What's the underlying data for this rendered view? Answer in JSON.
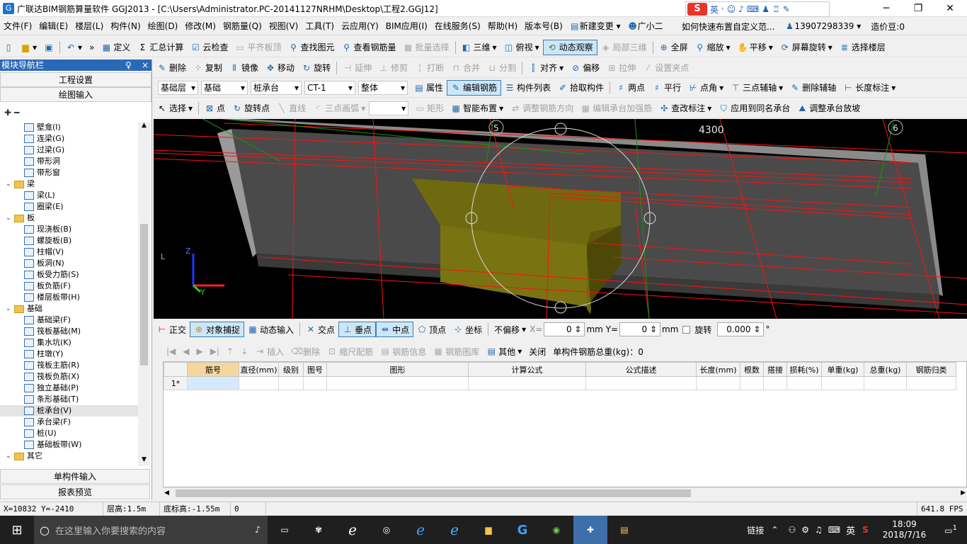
{
  "window": {
    "title": "广联达BIM钢筋算量软件 GGJ2013 - [C:\\Users\\Administrator.PC-20141127NRHM\\Desktop\\工程2.GGJ12]",
    "app_icon": "G"
  },
  "ime": {
    "logo": "S",
    "lang": "英",
    "icons": [
      "comma-icon",
      "smile-icon",
      "mic-icon",
      "keyboard-icon",
      "user-icon",
      "shirt-icon",
      "wrench-icon"
    ]
  },
  "window_controls": {
    "minimize": "─",
    "restore": "❐",
    "close": "✕"
  },
  "menu": [
    "文件(F)",
    "编辑(E)",
    "楼层(L)",
    "构件(N)",
    "绘图(D)",
    "修改(M)",
    "钢筋量(Q)",
    "视图(V)",
    "工具(T)",
    "云应用(Y)",
    "BIM应用(I)",
    "在线服务(S)",
    "帮助(H)",
    "版本号(B)",
    "新建变更",
    "广小二"
  ],
  "menu_right": {
    "hint": "如何快速布置自定义范...",
    "phone": "13907298339",
    "price": "造价豆:0"
  },
  "toolbar1": {
    "items": [
      "定义",
      "汇总计算",
      "云检查",
      "平齐板顶",
      "查找图元",
      "查看钢筋量",
      "批量选择",
      "三维",
      "俯视",
      "动态观察",
      "局部三维",
      "全屏",
      "缩放",
      "平移",
      "屏幕旋转",
      "选择楼层"
    ]
  },
  "toolbar2": {
    "items": [
      "删除",
      "复制",
      "镜像",
      "移动",
      "旋转",
      "延伸",
      "修剪",
      "打断",
      "合并",
      "分割",
      "对齐",
      "偏移",
      "拉伸",
      "设置夹点"
    ]
  },
  "toolbar3": {
    "layer_type": "基础层",
    "layer": "基础",
    "component_type": "桩承台",
    "component": "CT-1",
    "mode": "整体",
    "items": [
      "属性",
      "编辑钢筋",
      "构件列表",
      "拾取构件",
      "两点",
      "平行",
      "点角",
      "三点辅轴",
      "删除辅轴",
      "长度标注"
    ]
  },
  "toolbar4": {
    "items": [
      "选择",
      "点",
      "旋转点",
      "直线",
      "三点画弧",
      "矩形",
      "智能布置",
      "调整钢筋方向",
      "编辑承台加强筋",
      "查改标注",
      "应用到同名承台",
      "调整承台放坡"
    ]
  },
  "nav": {
    "title": "模块导航栏",
    "pin": "♀",
    "close": "×",
    "project_settings": "工程设置",
    "drawing_input": "绘图输入",
    "single_input": "单构件输入",
    "report_preview": "报表预览",
    "tree": [
      {
        "label": "壁龛(I)",
        "level": 2
      },
      {
        "label": "连梁(G)",
        "level": 2
      },
      {
        "label": "过梁(G)",
        "level": 2
      },
      {
        "label": "带形洞",
        "level": 2
      },
      {
        "label": "带形窗",
        "level": 2
      },
      {
        "label": "梁",
        "level": 1,
        "folder": true
      },
      {
        "label": "梁(L)",
        "level": 2
      },
      {
        "label": "圈梁(E)",
        "level": 2
      },
      {
        "label": "板",
        "level": 1,
        "folder": true
      },
      {
        "label": "现浇板(B)",
        "level": 2
      },
      {
        "label": "螺旋板(B)",
        "level": 2
      },
      {
        "label": "柱帽(V)",
        "level": 2
      },
      {
        "label": "板洞(N)",
        "level": 2
      },
      {
        "label": "板受力筋(S)",
        "level": 2
      },
      {
        "label": "板负筋(F)",
        "level": 2
      },
      {
        "label": "楼层板带(H)",
        "level": 2
      },
      {
        "label": "基础",
        "level": 1,
        "folder": true
      },
      {
        "label": "基础梁(F)",
        "level": 2
      },
      {
        "label": "筏板基础(M)",
        "level": 2
      },
      {
        "label": "集水坑(K)",
        "level": 2
      },
      {
        "label": "柱墩(Y)",
        "level": 2
      },
      {
        "label": "筏板主筋(R)",
        "level": 2
      },
      {
        "label": "筏板负筋(X)",
        "level": 2
      },
      {
        "label": "独立基础(P)",
        "level": 2
      },
      {
        "label": "条形基础(T)",
        "level": 2
      },
      {
        "label": "桩承台(V)",
        "level": 2,
        "selected": true
      },
      {
        "label": "承台梁(F)",
        "level": 2
      },
      {
        "label": "桩(U)",
        "level": 2
      },
      {
        "label": "基础板带(W)",
        "level": 2
      },
      {
        "label": "其它",
        "level": 1,
        "folder": true
      }
    ]
  },
  "viewport": {
    "dimension": "4300",
    "axis_a": "5",
    "axis_b": "6",
    "axis_z": "Z",
    "axis_y": "Y"
  },
  "snap": {
    "items": [
      "正交",
      "对象捕捉",
      "动态输入",
      "交点",
      "垂点",
      "中点",
      "顶点",
      "坐标"
    ],
    "offset": "不偏移",
    "x_label": "X=",
    "x": "0",
    "y_label": "mm Y=",
    "y": "0",
    "unit": "mm",
    "rotate": "旋转",
    "angle": "0.000",
    "deg": "°"
  },
  "rebar_toolbar": {
    "items": [
      "插入",
      "删除",
      "缩尺配筋",
      "钢筋信息",
      "钢筋图库",
      "其他",
      "关闭"
    ],
    "total": "单构件钢筋总重(kg)：0"
  },
  "grid": {
    "columns": [
      "筋号",
      "直径(mm)",
      "级别",
      "图号",
      "图形",
      "计算公式",
      "公式描述",
      "长度(mm)",
      "根数",
      "搭接",
      "损耗(%)",
      "单重(kg)",
      "总重(kg)",
      "钢筋归类"
    ],
    "row_label": "1*"
  },
  "status": {
    "coords": "X=10832 Y=-2410",
    "floor_height": "层高:1.5m",
    "bottom_height": "底标高:-1.55m",
    "num": "0",
    "fps": "641.8 FPS"
  },
  "taskbar": {
    "search": "在这里输入你要搜索的内容",
    "link": "链接",
    "lang": "英",
    "time": "18:09",
    "date": "2018/7/16",
    "notif": "1"
  }
}
